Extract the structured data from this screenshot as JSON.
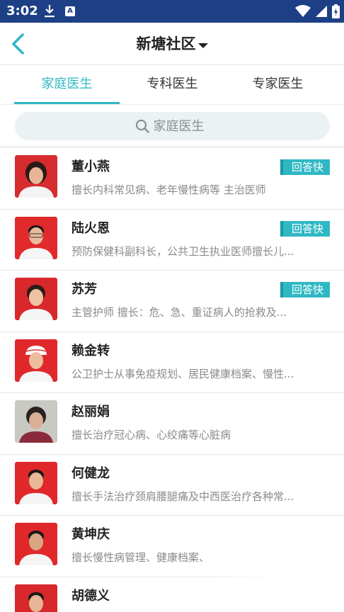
{
  "status_bar": {
    "time": "3:02",
    "a_icon": "A"
  },
  "header": {
    "title": "新塘社区"
  },
  "tabs": [
    {
      "label": "家庭医生",
      "active": true
    },
    {
      "label": "专科医生",
      "active": false
    },
    {
      "label": "专家医生",
      "active": false
    }
  ],
  "search": {
    "placeholder": "家庭医生"
  },
  "colors": {
    "accent": "#2fb8c3",
    "status_bar": "#1d3f86"
  },
  "doctors": [
    {
      "name": "董小燕",
      "desc": "擅长内科常见病、老年慢性病等 主治医师",
      "badge": "回答快",
      "avatar_bg": "#d62b2f"
    },
    {
      "name": "陆火恩",
      "desc": "预防保健科副科长，公共卫生执业医师擅长儿...",
      "badge": "回答快",
      "avatar_bg": "#e02a2c"
    },
    {
      "name": "苏芳",
      "desc": "主管护师 擅长：危、急、重证病人的抢救及...",
      "badge": "回答快",
      "avatar_bg": "#d9282c"
    },
    {
      "name": "赖金转",
      "desc": "公卫护士从事免疫规划、居民健康档案、慢性...",
      "badge": "",
      "avatar_bg": "#e0282b"
    },
    {
      "name": "赵丽娟",
      "desc": "擅长治疗冠心病、心绞痛等心脏病",
      "badge": "",
      "avatar_bg": "#c9c9c4"
    },
    {
      "name": "何健龙",
      "desc": "擅长手法治疗颈肩腰腿痛及中西医治疗各种常...",
      "badge": "",
      "avatar_bg": "#e0282b"
    },
    {
      "name": "黄坤庆",
      "desc": "擅长慢性病管理、健康档案、",
      "badge": "",
      "avatar_bg": "#e0282b"
    },
    {
      "name": "胡德义",
      "desc": "",
      "badge": "",
      "avatar_bg": "#d8282b"
    }
  ]
}
